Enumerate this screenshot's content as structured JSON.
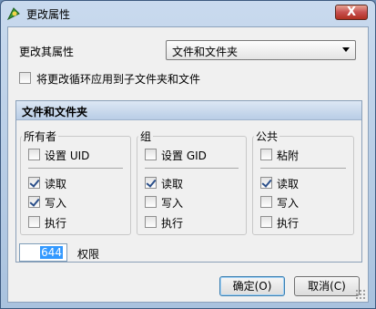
{
  "window": {
    "title": "更改属性",
    "close_label": "X"
  },
  "change_row": {
    "label": "更改其属性",
    "selected": "文件和文件夹"
  },
  "recursive": {
    "label": "将更改循环应用到子文件夹和文件",
    "checked": false
  },
  "panel": {
    "title": "文件和文件夹"
  },
  "groups": {
    "owner": {
      "title": "所有者",
      "special": "设置 UID",
      "read": "读取",
      "write": "写入",
      "exec": "执行"
    },
    "group": {
      "title": "组",
      "special": "设置 GID",
      "read": "读取",
      "write": "写入",
      "exec": "执行"
    },
    "public": {
      "title": "公共",
      "special": "粘附",
      "read": "读取",
      "write": "写入",
      "exec": "执行"
    }
  },
  "permissions": {
    "value": "644",
    "label": "权限"
  },
  "buttons": {
    "ok": "确定(O)",
    "cancel": "取消(C)"
  },
  "colors": {
    "titlebar": "#bcd1ea",
    "accent": "#3399ff",
    "close": "#c75050"
  }
}
